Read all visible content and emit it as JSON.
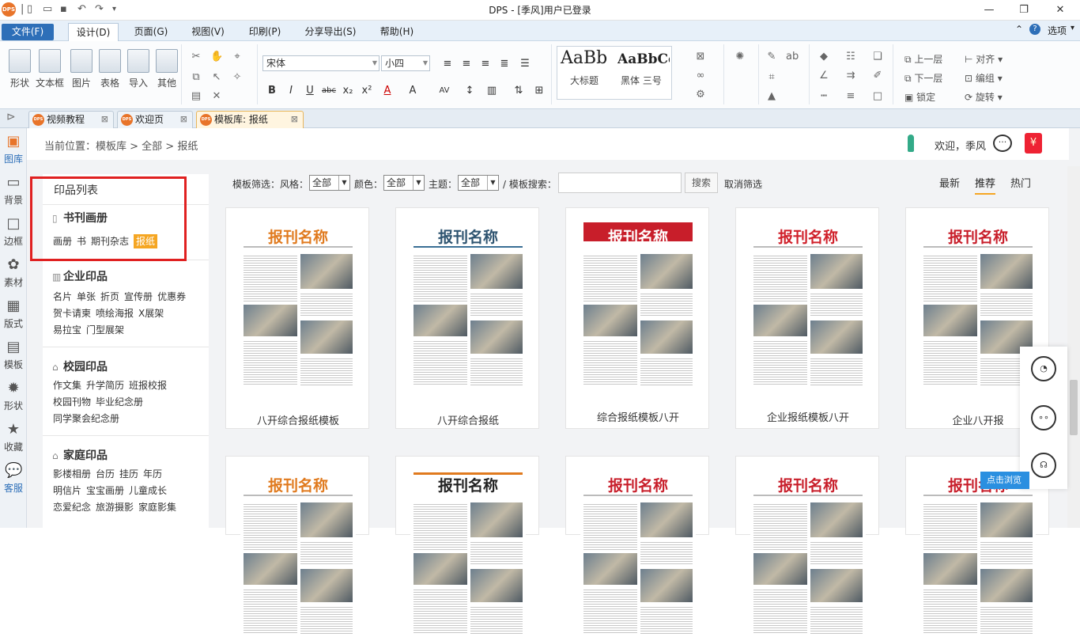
{
  "window": {
    "title": "DPS - [季风]用户已登录",
    "logo": "DPS"
  },
  "menubar": {
    "tabs": [
      "文件(F)",
      "设计(D)",
      "页面(G)",
      "视图(V)",
      "印刷(P)",
      "分享导出(S)",
      "帮助(H)"
    ],
    "options": "选项"
  },
  "ribbon": {
    "insert": [
      "形状",
      "文本框",
      "图片",
      "表格",
      "导入",
      "其他"
    ],
    "font_name": "宋体",
    "font_size": "小四",
    "styles": {
      "sample1": "AaBb",
      "sample2": "AaBbCc",
      "label1": "大标题",
      "label2": "黑体 三号"
    },
    "arrange": [
      "上一层",
      "下一层",
      "锁定",
      "对齐",
      "编组",
      "旋转"
    ]
  },
  "doctabs": [
    "视频教程",
    "欢迎页",
    "模板库: 报纸"
  ],
  "leftbar": [
    "图库",
    "背景",
    "边框",
    "素材",
    "版式",
    "模板",
    "形状",
    "收藏",
    "客服"
  ],
  "location": {
    "path": "当前位置：模板库 > 全部 > 报纸",
    "welcome": "欢迎，季风"
  },
  "catalog": {
    "head": "印品列表",
    "sections": [
      {
        "title": "书刊画册",
        "items": [
          "画册",
          "书",
          "期刊杂志",
          "报纸"
        ],
        "selected": "报纸"
      },
      {
        "title": "企业印品",
        "items": [
          "名片",
          "单张",
          "折页",
          "宣传册",
          "优惠券",
          "贺卡请柬",
          "喷绘海报",
          "X展架",
          "易拉宝",
          "门型展架"
        ]
      },
      {
        "title": "校园印品",
        "items": [
          "作文集",
          "升学简历",
          "班报校报",
          "校园刊物",
          "毕业纪念册",
          "同学聚会纪念册"
        ]
      },
      {
        "title": "家庭印品",
        "items": [
          "影楼相册",
          "台历",
          "挂历",
          "年历",
          "明信片",
          "宝宝画册",
          "儿童成长",
          "恋爱纪念",
          "旅游摄影",
          "家庭影集"
        ]
      }
    ]
  },
  "filter": {
    "label": "模板筛选：风格：",
    "style": "全部",
    "color_label": "颜色：",
    "color": "全部",
    "theme_label": "主题：",
    "theme": "全部",
    "search_label": "/ 模板搜索：",
    "search_btn": "搜索",
    "clear": "取消筛选",
    "sorts": [
      "最新",
      "推荐",
      "热门"
    ],
    "active_sort": "推荐"
  },
  "templates": [
    {
      "name": "八开综合报纸模板",
      "masthead": "报刊名称",
      "color": "#e07a1e"
    },
    {
      "name": "八开综合报纸",
      "masthead": "报刊名称",
      "color": "#2e5470"
    },
    {
      "name": "综合报纸模板八开",
      "masthead": "报刊名称",
      "color": "#ffffff"
    },
    {
      "name": "企业报纸模板八开",
      "masthead": "报刊名称",
      "color": "#d0202a"
    },
    {
      "name": "企业八开报",
      "masthead": "报刊名称",
      "color": "#c81e2a"
    },
    {
      "name": "",
      "masthead": "报刊名称",
      "color": "#e07a1e"
    },
    {
      "name": "",
      "masthead": "报刊名称",
      "color": "#222222"
    },
    {
      "name": "",
      "masthead": "报刊名称",
      "color": "#c81e2a"
    },
    {
      "name": "",
      "masthead": "报刊名称",
      "color": "#c81e2a"
    },
    {
      "name": "",
      "masthead": "报刊名称",
      "color": "#c81e2a"
    }
  ],
  "float": {
    "browse": "点击浏览"
  }
}
